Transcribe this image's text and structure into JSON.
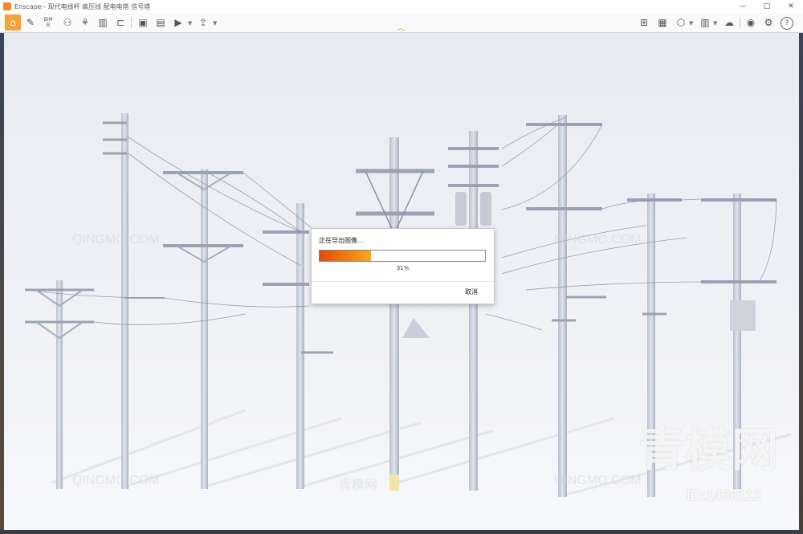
{
  "window": {
    "title": "Enscape - 现代电线杆 高压线 配电电塔 信号塔",
    "controls": [
      "—",
      "□",
      "✕"
    ]
  },
  "toolbar": {
    "left_icons": [
      "home-icon",
      "ruler-icon",
      "list-icon",
      "bim-icon",
      "gamepad-icon",
      "asset-icon",
      "buildings-icon",
      "buildings-alt-icon",
      "chair-icon",
      "screenshot-icon",
      "batch-render-icon",
      "video-export-icon",
      "export-icon"
    ],
    "right_icons": [
      "map-icon",
      "gallery-icon",
      "cube-icon",
      "books-icon",
      "cloud-icon",
      "eye-icon",
      "gear-icon",
      "help-icon"
    ],
    "bim_label": "BIM",
    "help_label": "?"
  },
  "dialog": {
    "title": "正在导出图像...",
    "progress": 0.31,
    "percent_label": "31%",
    "cancel_label": "取消"
  },
  "watermarks": {
    "site": "QINGMO.COM",
    "site_cn": "青模网",
    "big": "青模网",
    "id": "ID:1456112"
  },
  "colors": {
    "accent": "#f3a33a",
    "progress_start": "#e84a0c",
    "progress_end": "#f8a81a"
  }
}
